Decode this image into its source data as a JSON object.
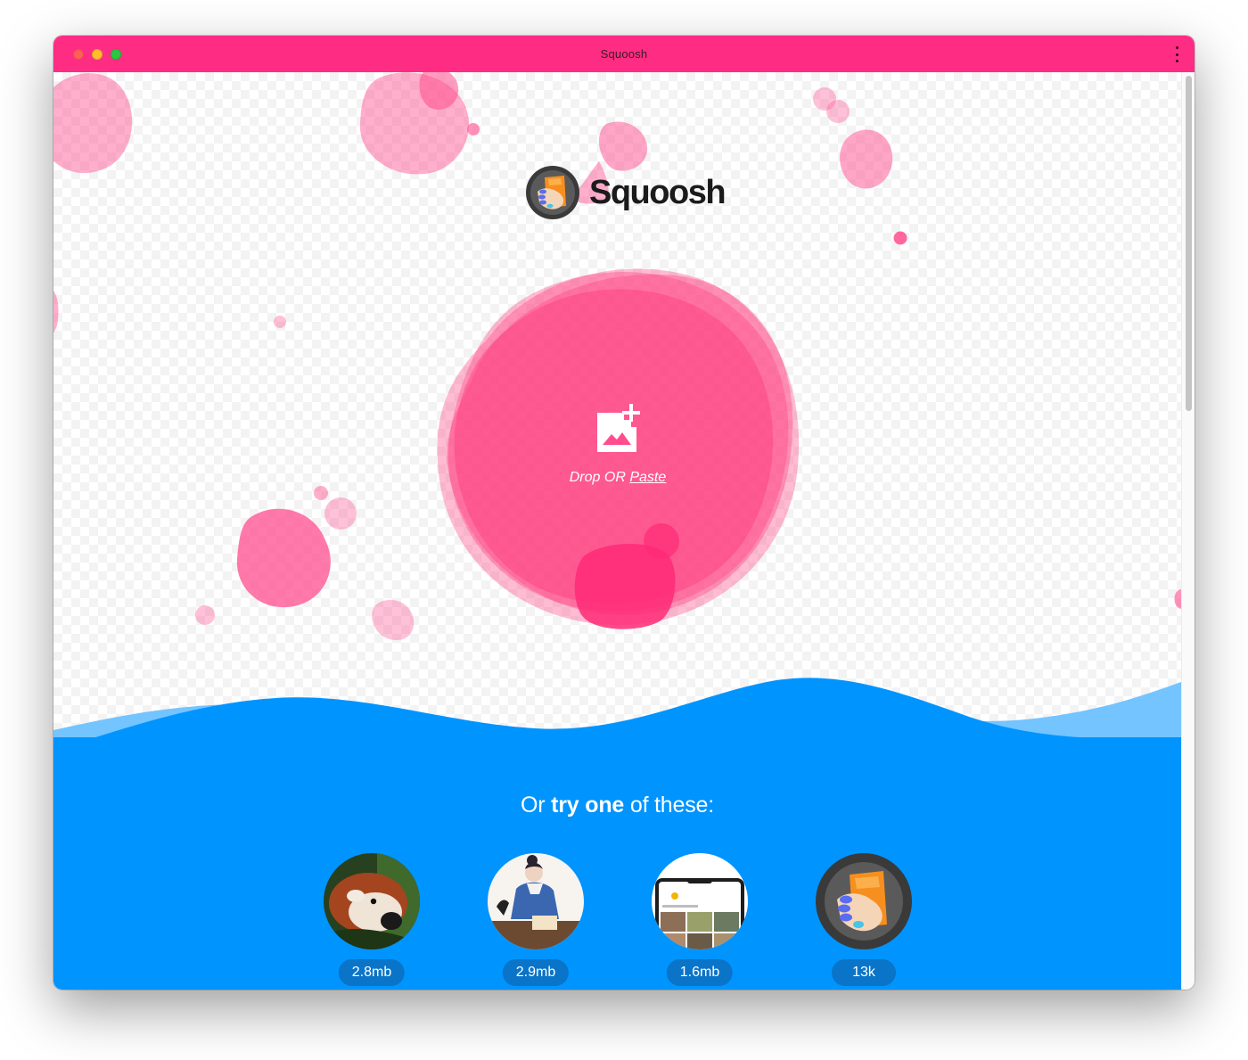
{
  "window": {
    "title": "Squoosh"
  },
  "logo": {
    "text": "Squoosh"
  },
  "drop_zone": {
    "drop_label": "Drop OR",
    "paste_label": "Paste"
  },
  "demo_heading": {
    "prefix": "Or",
    "emphasis": "try one",
    "suffix": "of these:"
  },
  "demos": [
    {
      "name": "red-panda",
      "size": "2.8mb"
    },
    {
      "name": "artwork",
      "size": "2.9mb"
    },
    {
      "name": "device-screen",
      "size": "1.6mb"
    },
    {
      "name": "squoosh-logo",
      "size": "13k"
    }
  ],
  "colors": {
    "accent_pink": "#ff2c83",
    "wave_blue": "#0094ff",
    "wave_light_blue": "#74c4ff",
    "pill_blue": "#0a74c8"
  },
  "icons": [
    "kebab-menu-icon",
    "add-image-icon",
    "squoosh-logo-icon"
  ]
}
